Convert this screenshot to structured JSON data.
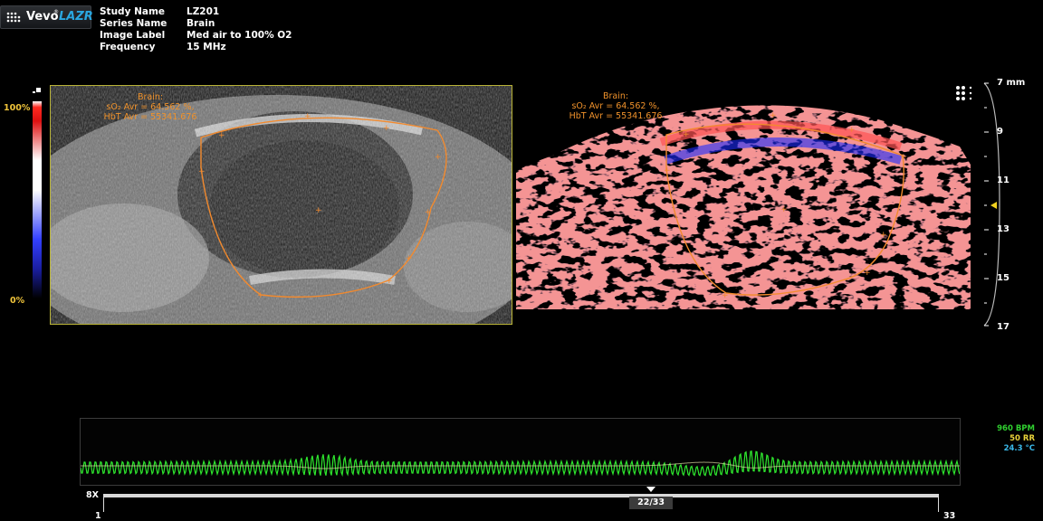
{
  "logo": {
    "brand": "Vevo",
    "product": "LAZR",
    "trademark": "®"
  },
  "metadata": [
    {
      "key": "Study Name",
      "value": "LZ201"
    },
    {
      "key": "Series Name",
      "value": "Brain"
    },
    {
      "key": "Image Label",
      "value": "Med air to 100% O2"
    },
    {
      "key": "Frequency",
      "value": "15 MHz"
    }
  ],
  "scale": {
    "top": "100%",
    "bottom": "0%"
  },
  "roi_us": {
    "name": "Brain:",
    "line1": "sO₂ Avr = 64.562 %,",
    "line2": "HbT Avr = 55341.676"
  },
  "roi_pa": {
    "name": "Brain:",
    "line1": "sO₂ Avr = 64.562 %,",
    "line2": "HbT Avr = 55341.676"
  },
  "depth": {
    "unit_label": "7 mm",
    "labels": [
      "9",
      "11",
      "13",
      "15",
      "17"
    ]
  },
  "vitals": {
    "heart": "960 BPM",
    "resp": "50 RR",
    "temp": "24.3 °C"
  },
  "vital_colors": {
    "heart": "#30d030",
    "resp": "#e8d23a",
    "temp": "#3ab8e8"
  },
  "playback": {
    "zoom": "8X",
    "start": "1",
    "end": "33",
    "frame": "22/33",
    "current": 22,
    "total": 33
  }
}
